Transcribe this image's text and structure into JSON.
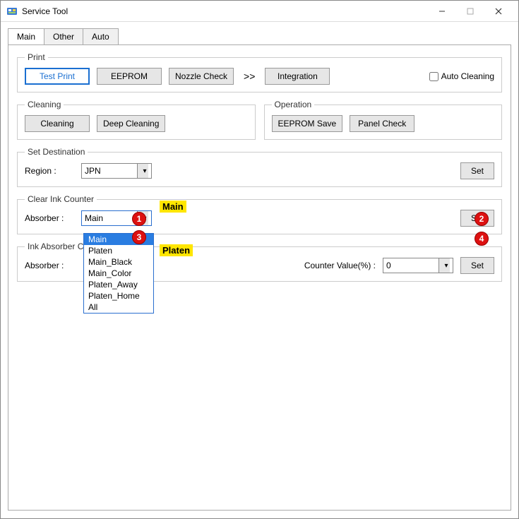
{
  "titlebar": {
    "title": "Service Tool"
  },
  "tabs": {
    "t0": "Main",
    "t1": "Other",
    "t2": "Auto"
  },
  "print": {
    "legend": "Print",
    "test_print": "Test Print",
    "eeprom": "EEPROM",
    "nozzle": "Nozzle Check",
    "sep": ">>",
    "integration": "Integration",
    "auto_clean": "Auto Cleaning"
  },
  "cleaning": {
    "legend": "Cleaning",
    "clean": "Cleaning",
    "deep": "Deep Cleaning"
  },
  "operation": {
    "legend": "Operation",
    "save": "EEPROM Save",
    "panel": "Panel Check"
  },
  "dest": {
    "legend": "Set Destination",
    "region_label": "Region :",
    "region_value": "JPN",
    "set": "Set"
  },
  "clearink": {
    "legend": "Clear Ink Counter",
    "absorber_label": "Absorber :",
    "absorber_value": "Main",
    "set": "Set",
    "options": {
      "o0": "Main",
      "o1": "Platen",
      "o2": "Main_Black",
      "o3": "Main_Color",
      "o4": "Platen_Away",
      "o5": "Platen_Home",
      "o6": "All"
    }
  },
  "inkabs": {
    "legend_partial": "Ink Absorber C",
    "absorber_label": "Absorber :",
    "counter_label": "Counter Value(%) :",
    "counter_value": "0",
    "set": "Set"
  },
  "annotations": {
    "a1": "1",
    "a2": "2",
    "a3": "3",
    "a4": "4",
    "t_main": "Main",
    "t_platen": "Platen"
  }
}
